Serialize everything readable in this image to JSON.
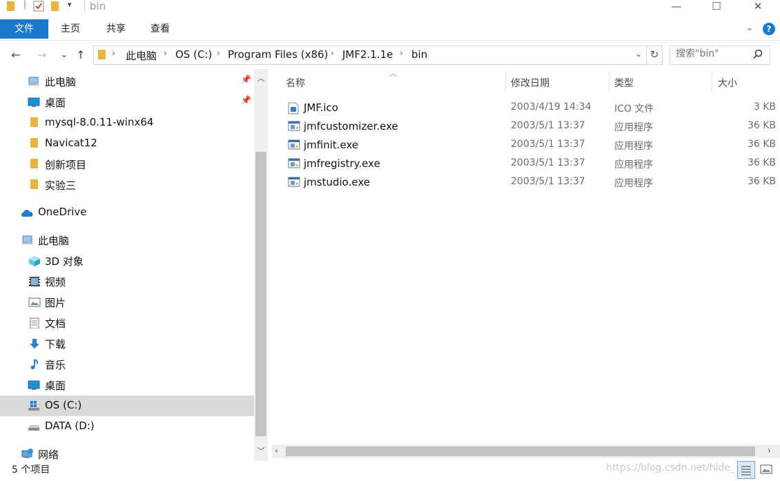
{
  "window": {
    "title": "bin",
    "controls": {
      "minimize": "—",
      "maximize": "☐",
      "close": "✕"
    }
  },
  "ribbon": {
    "tabs": [
      "文件",
      "主页",
      "共享",
      "查看"
    ],
    "active_tab": "文件",
    "help": "?"
  },
  "nav": {
    "back": "←",
    "forward": "→",
    "recent": "⌄",
    "up": "↑",
    "breadcrumbs": [
      "此电脑",
      "OS (C:)",
      "Program Files (x86)",
      "JMF2.1.1e",
      "bin"
    ],
    "refresh": "↻"
  },
  "search": {
    "placeholder": "搜索\"bin\""
  },
  "sidebar": {
    "quick_access": [
      {
        "label": "此电脑",
        "icon": "computer-icon",
        "pinned": true
      },
      {
        "label": "桌面",
        "icon": "desktop-icon",
        "pinned": true
      },
      {
        "label": "mysql-8.0.11-winx64",
        "icon": "folder-icon",
        "pinned": false
      },
      {
        "label": "Navicat12",
        "icon": "folder-icon",
        "pinned": false
      },
      {
        "label": "创新项目",
        "icon": "folder-icon",
        "pinned": false
      },
      {
        "label": "实验三",
        "icon": "folder-icon",
        "pinned": false
      }
    ],
    "onedrive": "OneDrive",
    "this_pc": "此电脑",
    "this_pc_items": [
      {
        "label": "3D 对象",
        "icon": "3d-objects-icon"
      },
      {
        "label": "视频",
        "icon": "videos-icon"
      },
      {
        "label": "图片",
        "icon": "pictures-icon"
      },
      {
        "label": "文档",
        "icon": "documents-icon"
      },
      {
        "label": "下载",
        "icon": "downloads-icon"
      },
      {
        "label": "音乐",
        "icon": "music-icon"
      },
      {
        "label": "桌面",
        "icon": "desktop-icon"
      },
      {
        "label": "OS (C:)",
        "icon": "windows-drive-icon",
        "selected": true
      },
      {
        "label": "DATA (D:)",
        "icon": "drive-icon"
      }
    ],
    "network": "网络"
  },
  "columns": {
    "name": "名称",
    "modified": "修改日期",
    "type": "类型",
    "size": "大小"
  },
  "files": [
    {
      "name": "JMF.ico",
      "modified": "2003/4/19 14:34",
      "type": "ICO 文件",
      "size": "3 KB",
      "icon": "ico-file-icon"
    },
    {
      "name": "jmfcustomizer.exe",
      "modified": "2003/5/1 13:37",
      "type": "应用程序",
      "size": "36 KB",
      "icon": "exe-file-icon"
    },
    {
      "name": "jmfinit.exe",
      "modified": "2003/5/1 13:37",
      "type": "应用程序",
      "size": "36 KB",
      "icon": "exe-file-icon"
    },
    {
      "name": "jmfregistry.exe",
      "modified": "2003/5/1 13:37",
      "type": "应用程序",
      "size": "36 KB",
      "icon": "exe-file-icon"
    },
    {
      "name": "jmstudio.exe",
      "modified": "2003/5/1 13:37",
      "type": "应用程序",
      "size": "36 KB",
      "icon": "exe-file-icon"
    }
  ],
  "status": {
    "item_count": "5 个项目",
    "watermark": "https://blog.csdn.net/hide_"
  },
  "colors": {
    "accent": "#1979ca",
    "selected": "#d9d9d9",
    "folder": "#e8b53c"
  }
}
